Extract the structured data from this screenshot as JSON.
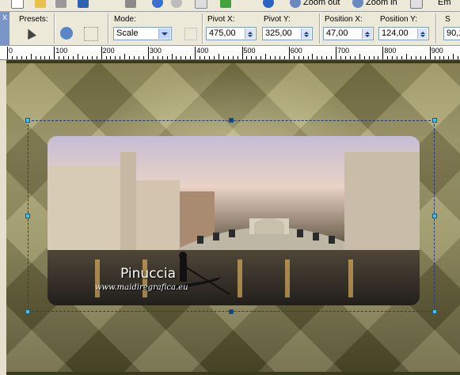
{
  "toolbar": {
    "zoom_out_label": "Zoom out",
    "zoom_in_label": "Zoom in",
    "cut_text": "Em"
  },
  "options": {
    "pin_icon": "x",
    "presets_label": "Presets:",
    "mode_label": "Mode:",
    "mode_value": "Scale",
    "pivot_x_label": "Pivot X:",
    "pivot_x_value": "475,00",
    "pivot_y_label": "Pivot Y:",
    "pivot_y_value": "325,00",
    "position_x_label": "Position X:",
    "position_x_value": "47,00",
    "position_y_label": "Position Y:",
    "position_y_value": "124,00",
    "cut_label": "S",
    "cut_value": "90,1"
  },
  "ruler": {
    "labels": [
      "0",
      "100",
      "200",
      "300",
      "400",
      "500",
      "600",
      "700",
      "800",
      "900"
    ]
  },
  "canvas": {
    "watermark_title": "Pinuccia",
    "watermark_url": "www.maidiregrafica.eu"
  },
  "colors": {
    "accent_blue": "#203c7a",
    "handle_cyan": "#47c0ea",
    "panel_bg": "#ece9d8"
  }
}
